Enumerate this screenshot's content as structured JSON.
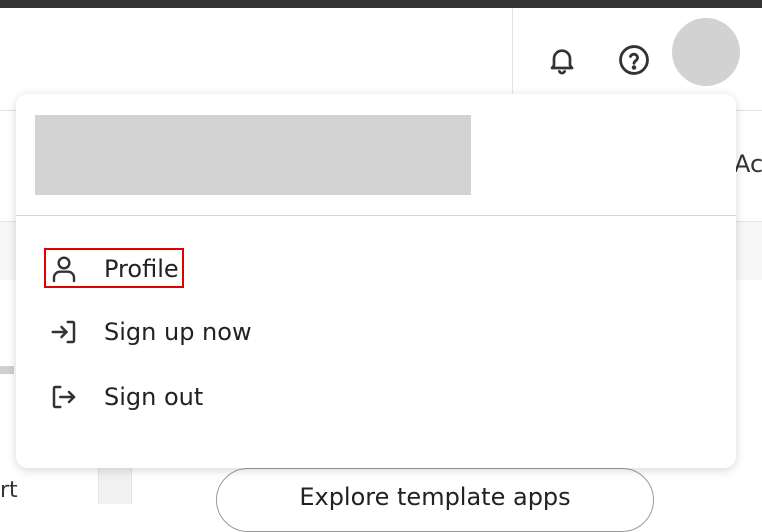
{
  "header": {
    "notifications_icon": "bell-icon",
    "help_icon": "help-circle-icon"
  },
  "background": {
    "tab_partial": "Ac",
    "sidebar_partial": "rt",
    "explore_button": "Explore template apps"
  },
  "menu": {
    "items": [
      {
        "label": "Profile",
        "icon": "user-icon"
      },
      {
        "label": "Sign up now",
        "icon": "sign-in-icon"
      },
      {
        "label": "Sign out",
        "icon": "sign-out-icon"
      }
    ]
  },
  "colors": {
    "highlight": "#e00000",
    "placeholder": "#d3d3d3",
    "icon": "#333333"
  }
}
